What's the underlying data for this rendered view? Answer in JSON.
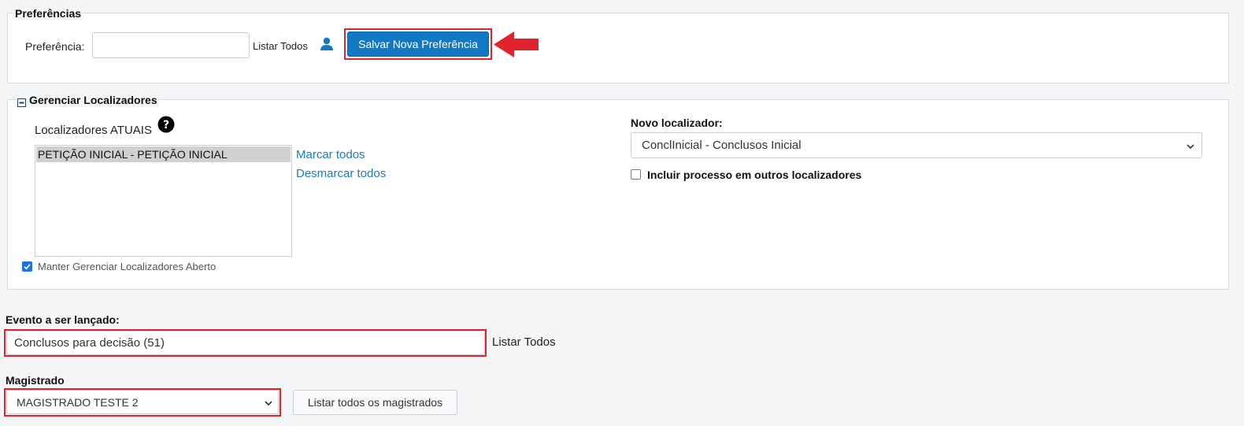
{
  "preferencias": {
    "legend": "Preferências",
    "field_label": "Preferência:",
    "field_value": "",
    "listar_todos": "Listar Todos",
    "save_button": "Salvar Nova Preferência",
    "user_icon": "user-icon"
  },
  "localizadores": {
    "legend": "Gerenciar Localizadores",
    "collapse_icon": "minus-square-icon",
    "atuais_label": "Localizadores ATUAIS",
    "help_icon": "question-circle-icon",
    "items": [
      "PETIÇÃO INICIAL - PETIÇÃO INICIAL"
    ],
    "marcar_todos": "Marcar todos",
    "desmarcar_todos": "Desmarcar todos",
    "manter_aberto_label": "Manter Gerenciar Localizadores Aberto",
    "manter_aberto_checked": true,
    "novo_label": "Novo localizador:",
    "novo_value": "ConclInicial - Conclusos Inicial",
    "incluir_label": "Incluir processo em outros localizadores",
    "incluir_checked": false
  },
  "evento": {
    "label": "Evento a ser lançado:",
    "value": "Conclusos para decisão (51)",
    "listar_todos": "Listar Todos"
  },
  "magistrado": {
    "label": "Magistrado",
    "value": "MAGISTRADO TESTE 2",
    "listar_button": "Listar todos os magistrados"
  },
  "colors": {
    "primary": "#1179c4",
    "highlight": "#e0242e",
    "link": "#1a7bbf"
  }
}
